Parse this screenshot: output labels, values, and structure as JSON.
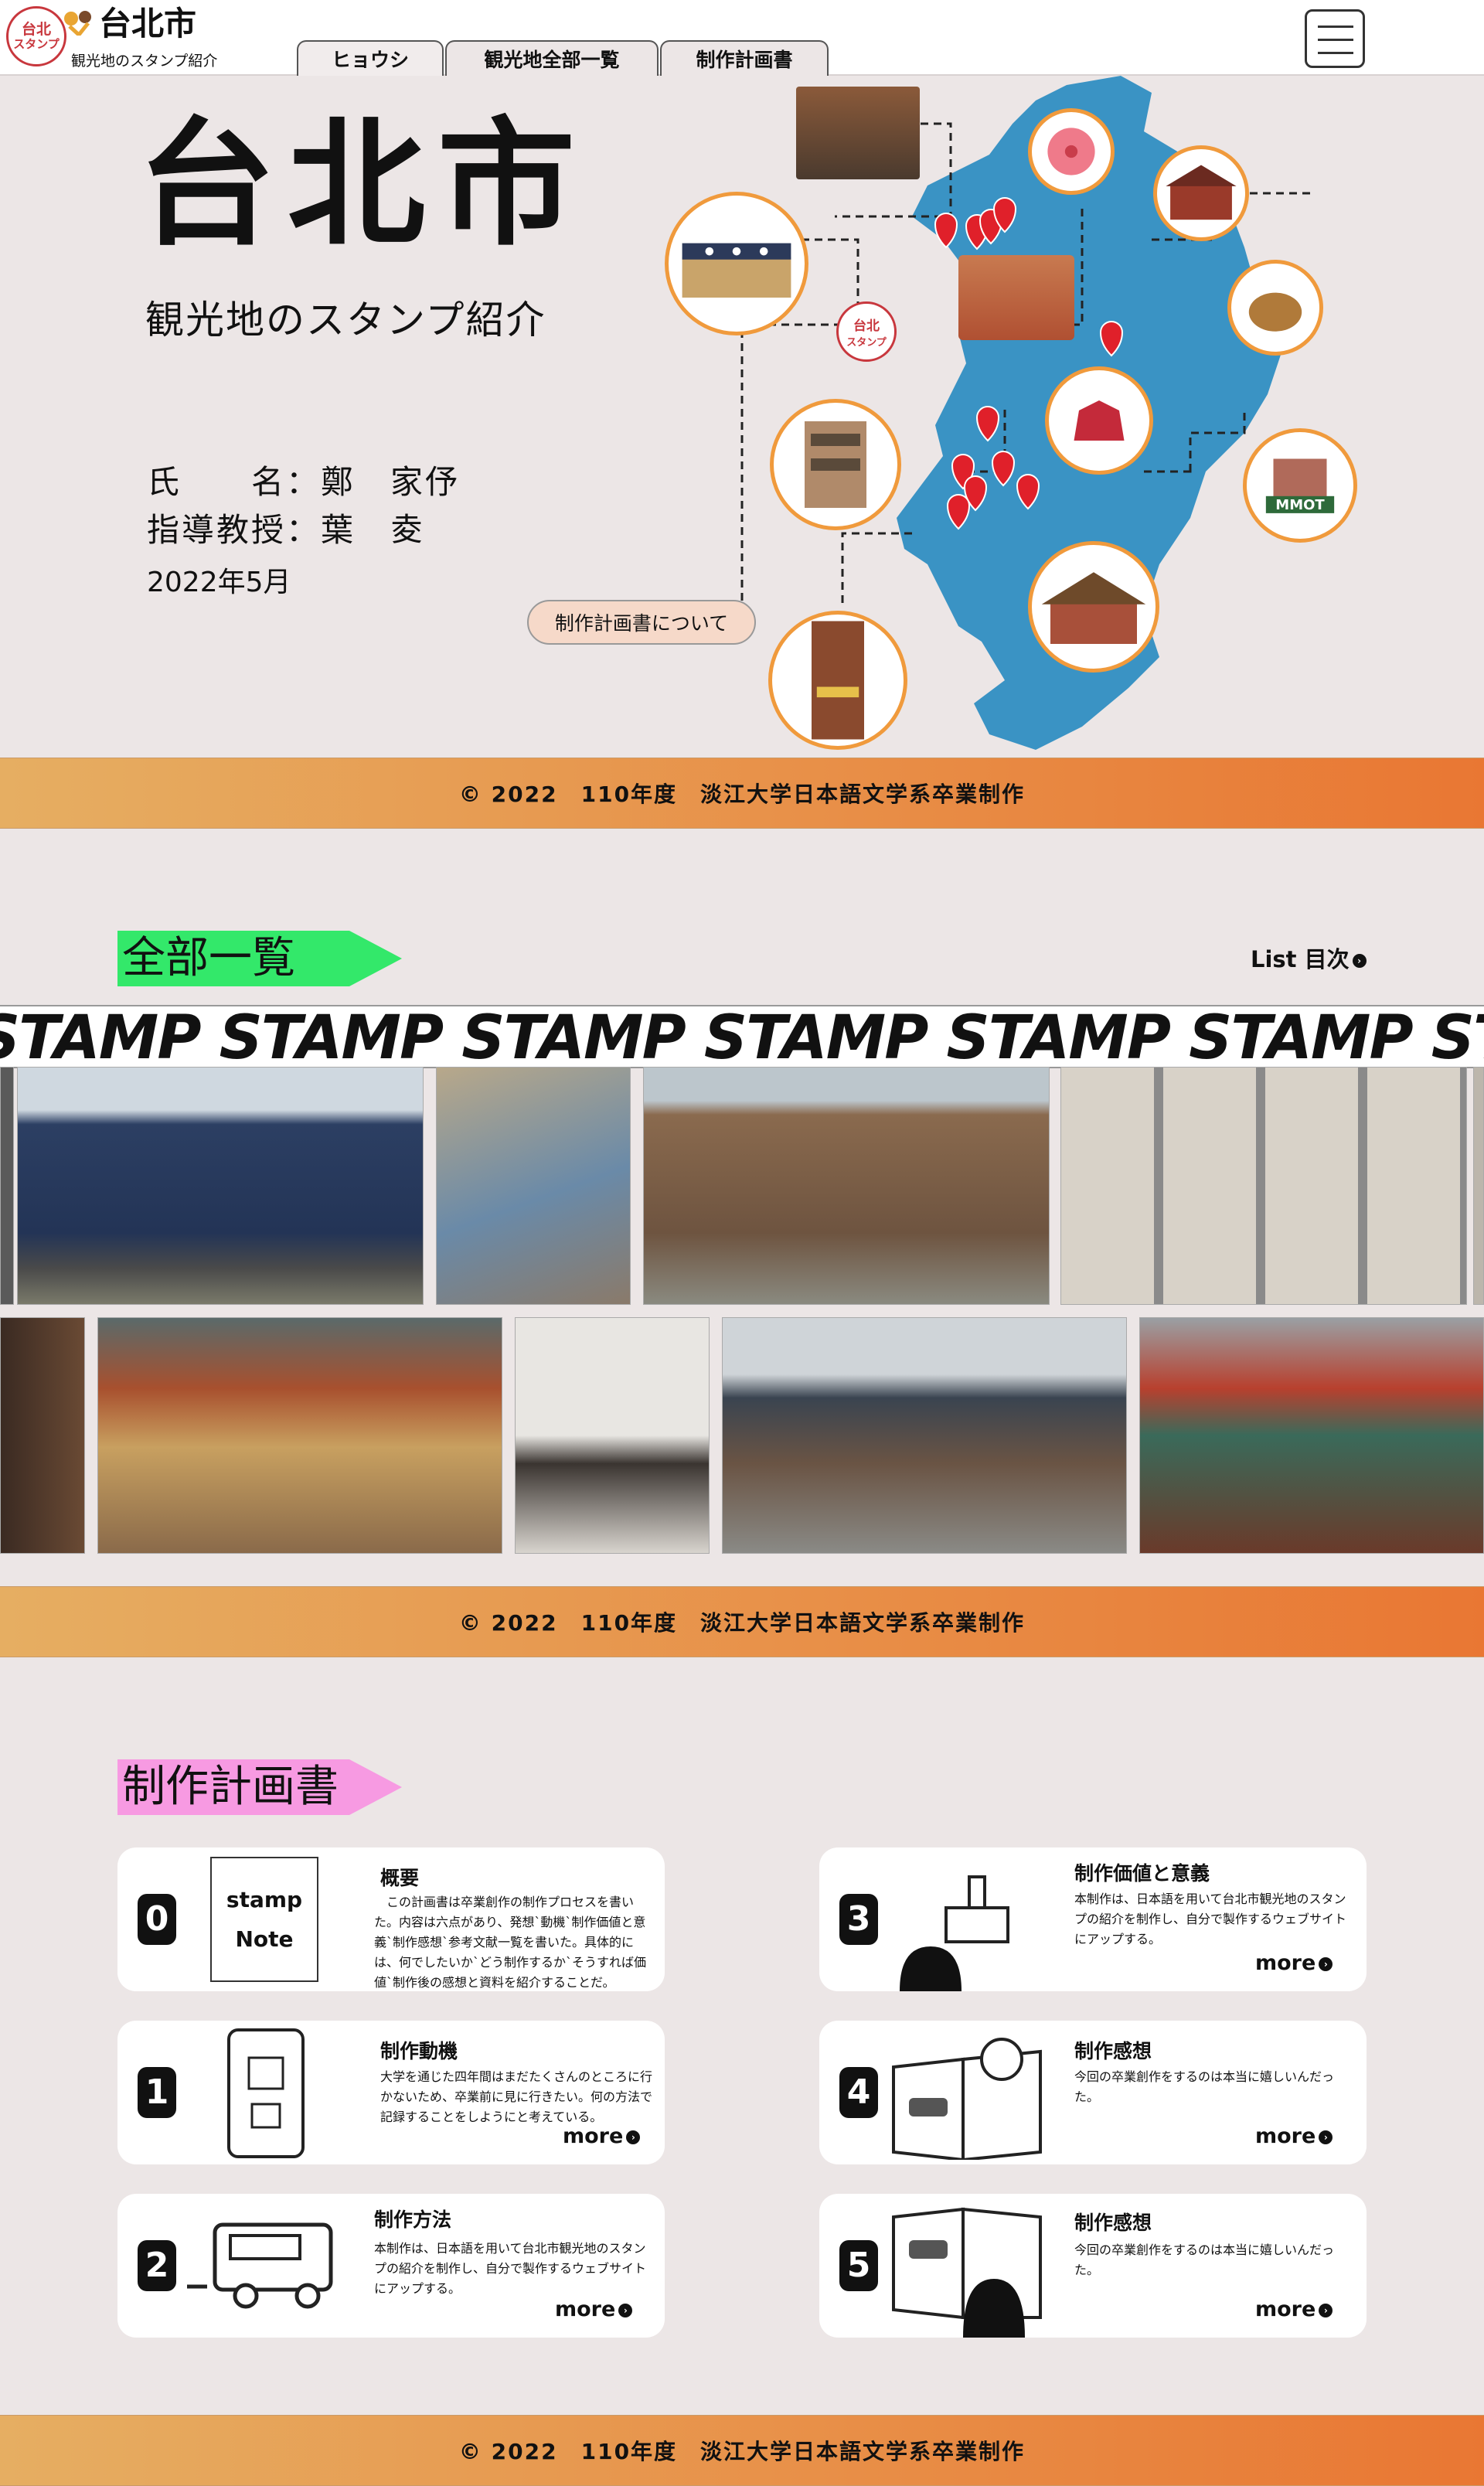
{
  "header": {
    "logo_top": "台北",
    "logo_bottom": "スタンプ",
    "brand": "台北市",
    "brand_sub": "観光地のスタンプ紹介",
    "tabs": [
      {
        "label": "ヒョウシ"
      },
      {
        "label": "観光地全部一覧"
      },
      {
        "label": "制作計画書"
      }
    ]
  },
  "hero": {
    "title": "台北市",
    "subtitle": "観光地のスタンプ紹介",
    "name_line": "氏　　名：鄭　家伃",
    "advisor_line": "指導教授：葉　夌",
    "date": "2022年5月",
    "plan_button": "制作計画書について",
    "map_logo_top": "台北",
    "map_logo_bottom": "スタンプ",
    "mmot_label": "MMOT"
  },
  "footer": {
    "text": "© 2022　110年度　淡江大学日本語文学系卒業制作"
  },
  "list_section": {
    "title": "全部一覧",
    "link": "List 目次",
    "marquee": "STAMP STAMP STAMP STAMP STAMP STAMP STAMP STAMP STAMP"
  },
  "plan_section": {
    "title": "制作計画書",
    "note_icon_top": "stamp",
    "note_icon_bottom": "Note",
    "cards": [
      {
        "num": "0",
        "title": "概要",
        "body": "　この計画書は卒業創作の制作プロセスを書いた。内容は六点があり、発想`動機`制作価値と意義`制作感想`参考文献一覧を書いた。具体的には、何でしたいか`どう制作するか`そうすれば価値`制作後の感想と資料を紹介することだ。",
        "more": ""
      },
      {
        "num": "1",
        "title": "制作動機",
        "body": "大学を通じた四年間はまだたくさんのところに行かないため、卒業前に見に行きたい。何の方法で記録することをしようにと考えている。",
        "more": "more"
      },
      {
        "num": "2",
        "title": "制作方法",
        "body": "本制作は、日本語を用いて台北市観光地のスタンプの紹介を制作し、自分で製作するウェブサイトにアップする。",
        "more": "more"
      },
      {
        "num": "3",
        "title": "制作価値と意義",
        "body": "本制作は、日本語を用いて台北市観光地のスタンプの紹介を制作し、自分で製作するウェブサイトにアップする。",
        "more": "more"
      },
      {
        "num": "4",
        "title": "制作感想",
        "body": "今回の卒業創作をするのは本当に嬉しいんだった。",
        "more": "more"
      },
      {
        "num": "5",
        "title": "制作感想",
        "body": "今回の卒業創作をするのは本当に嬉しいんだった。",
        "more": "more"
      }
    ]
  },
  "icons": {
    "menu": "hamburger-icon",
    "arrow": "arrow-circle-icon",
    "pin": "map-pin-icon"
  },
  "colors": {
    "orange": "#f09a3c",
    "map_blue": "#3a93c4",
    "green_tag": "#33e86a",
    "pink_tag": "#f79ae2",
    "pin_red": "#e0202a"
  }
}
